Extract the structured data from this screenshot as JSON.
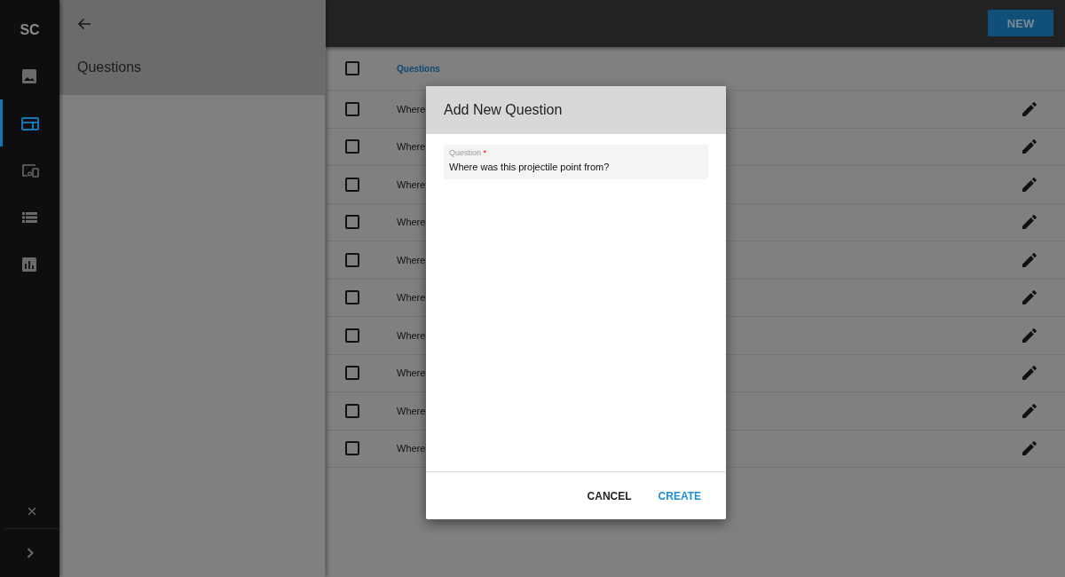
{
  "rail": {
    "logo": "SC",
    "items": [
      {
        "selected": false
      },
      {
        "selected": true
      },
      {
        "selected": false
      },
      {
        "selected": false
      },
      {
        "selected": false
      }
    ]
  },
  "panel": {
    "title": "Questions"
  },
  "toolbar": {
    "new_button": "NEW"
  },
  "table": {
    "header": {
      "checked": false,
      "column": "Questions"
    },
    "rows": [
      {
        "text": "Where",
        "checked": false
      },
      {
        "text": "Where",
        "checked": false
      },
      {
        "text": "Where",
        "checked": false
      },
      {
        "text": "Where",
        "checked": false
      },
      {
        "text": "Where",
        "checked": false
      },
      {
        "text": "Where",
        "checked": false
      },
      {
        "text": "Where",
        "checked": false
      },
      {
        "text": "Where",
        "checked": false
      },
      {
        "text": "Where",
        "checked": false
      },
      {
        "text": "Where",
        "checked": false
      }
    ]
  },
  "dialog": {
    "title": "Add New Question",
    "field": {
      "label": "Question",
      "required_mark": "*",
      "value": "Where was this projectile point from?"
    },
    "buttons": [
      {
        "label": "CANCEL",
        "kind": "secondary"
      },
      {
        "label": "CREATE",
        "kind": "primary"
      }
    ]
  }
}
